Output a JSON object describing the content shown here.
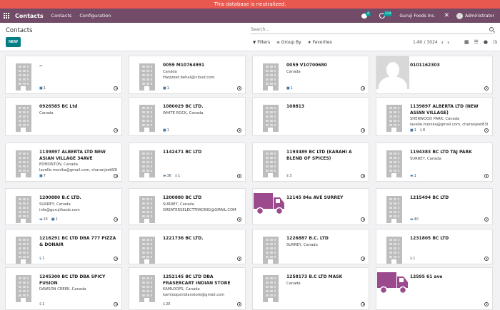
{
  "banner": "This database is neutralized.",
  "nav": {
    "brand": "Contacts",
    "menu": [
      "Contacts",
      "Configuration"
    ],
    "chat_count": "4",
    "activity_count": "314",
    "company": "Guruji Foods Inc.",
    "user": "Administrator"
  },
  "control": {
    "title": "Contacts",
    "new_label": "NEW",
    "search_placeholder": "Search...",
    "filters_label": "Filters",
    "groupby_label": "Group By",
    "favorites_label": "Favorites",
    "pager": "1-80 / 3024"
  },
  "cards": [
    {
      "name": "..",
      "lines": [],
      "bottom": [
        {
          "icon": "briefcase",
          "text": "1"
        }
      ],
      "image": "building"
    },
    {
      "name": "0059 M10764991",
      "lines": [
        "Canada",
        "Harpreet.behal@icloud.com"
      ],
      "bottom": [
        {
          "icon": "briefcase",
          "text": "1"
        }
      ],
      "image": "building"
    },
    {
      "name": "0059 V10700680",
      "lines": [
        "Canada"
      ],
      "bottom": [
        {
          "icon": "briefcase",
          "text": "1"
        }
      ],
      "image": "building"
    },
    {
      "name": "0101162303",
      "lines": [],
      "bottom": [],
      "image": "person"
    },
    {
      "name": "0926585 BC Ltd",
      "lines": [
        "Canada"
      ],
      "bottom": [],
      "image": "building"
    },
    {
      "name": "1080029 BC LTD.",
      "lines": [
        "WHITE ROCK, Canada"
      ],
      "bottom": [
        {
          "icon": "briefcase",
          "text": "1"
        }
      ],
      "image": "building"
    },
    {
      "name": "108813",
      "lines": [],
      "bottom": [],
      "image": "building"
    },
    {
      "name": "1139897 ALBERTA LTD (NEW ASIAN VILLAGE)",
      "lines": [
        "SHERWOOD PARK, Canada",
        "lavelle.monika@gmail.com, charanjeet8304@g..."
      ],
      "bottom": [
        {
          "icon": "briefcase",
          "text": "1"
        },
        {
          "icon": "dollar",
          "text": "8"
        }
      ],
      "image": "building"
    },
    {
      "name": "1139897 ALBERTA LTD NEW ASIAN VILLAGE 34AVE",
      "lines": [
        "EDMONTON, Canada",
        "lavelle.monika@gmail.com, charanjeet8304@g..."
      ],
      "bottom": [
        {
          "icon": "briefcase",
          "text": "7"
        }
      ],
      "image": "building"
    },
    {
      "name": "1142471 BC LTD",
      "lines": [],
      "bottom": [
        {
          "icon": "credit-card",
          "text": "36"
        },
        {
          "icon": "dollar",
          "text": "1"
        }
      ],
      "image": "building"
    },
    {
      "name": "1193489 BC LTD (KARAHI A BLEND OF SPICES)",
      "lines": [],
      "bottom": [
        {
          "icon": "dollar",
          "text": "3"
        }
      ],
      "image": "building"
    },
    {
      "name": "1194383 BC LTD TAJ PARK",
      "lines": [
        "SURREY, Canada"
      ],
      "bottom": [
        {
          "icon": "credit-card",
          "text": "1"
        }
      ],
      "image": "building"
    },
    {
      "name": "1200880 B.C LTD.",
      "lines": [
        "SURREY, Canada",
        "info@gurujifoods.com"
      ],
      "bottom": [
        {
          "icon": "credit-card",
          "text": "23"
        },
        {
          "icon": "briefcase",
          "text": "2"
        }
      ],
      "image": "building"
    },
    {
      "name": "1200880 BC LTD",
      "lines": [
        "SURREY, Canada",
        "GREATERSELECTTRADING@GMAIL.COM"
      ],
      "bottom": [],
      "image": "building"
    },
    {
      "name": "12145 84a AVE SURREY",
      "lines": [],
      "bottom": [],
      "image": "truck"
    },
    {
      "name": "1215494 BC LTD",
      "lines": [],
      "bottom": [
        {
          "icon": "credit-card",
          "text": "40"
        }
      ],
      "image": "building"
    },
    {
      "name": "1216291 BC LTD DBA 777 PIZZA & DONAIR",
      "lines": [],
      "bottom": [
        {
          "icon": "dollar",
          "text": "1"
        }
      ],
      "image": "building"
    },
    {
      "name": "1221736 BC LTD.",
      "lines": [],
      "bottom": [],
      "image": "building"
    },
    {
      "name": "1226887 B.C. LTD",
      "lines": [
        "SURREY, Canada"
      ],
      "bottom": [],
      "image": "building"
    },
    {
      "name": "1231805 BC LTD",
      "lines": [],
      "bottom": [
        {
          "icon": "dollar",
          "text": "1"
        }
      ],
      "image": "building"
    },
    {
      "name": "1245300 BC LTD DBA SPICY FUSION",
      "lines": [
        "DAWSON CREEK, Canada"
      ],
      "bottom": [
        {
          "icon": "dollar",
          "text": "1"
        }
      ],
      "image": "building"
    },
    {
      "name": "1252145 BC LTD DBA FRASERCART INDIAN STORE",
      "lines": [
        "KAMLOOPS, Canada",
        "kamloopsindianstore@gmail.com"
      ],
      "bottom": [
        {
          "icon": "dollar",
          "text": "20"
        }
      ],
      "image": "building"
    },
    {
      "name": "1258173 B.C LTD MASK",
      "lines": [
        "Canada"
      ],
      "bottom": [],
      "image": "building"
    },
    {
      "name": "12595 61 ave",
      "lines": [],
      "bottom": [],
      "image": "truck"
    }
  ],
  "colors": {
    "brand": "#714b67",
    "banner": "#e8584f",
    "primary": "#017e84",
    "truck": "#9c4a8e"
  }
}
